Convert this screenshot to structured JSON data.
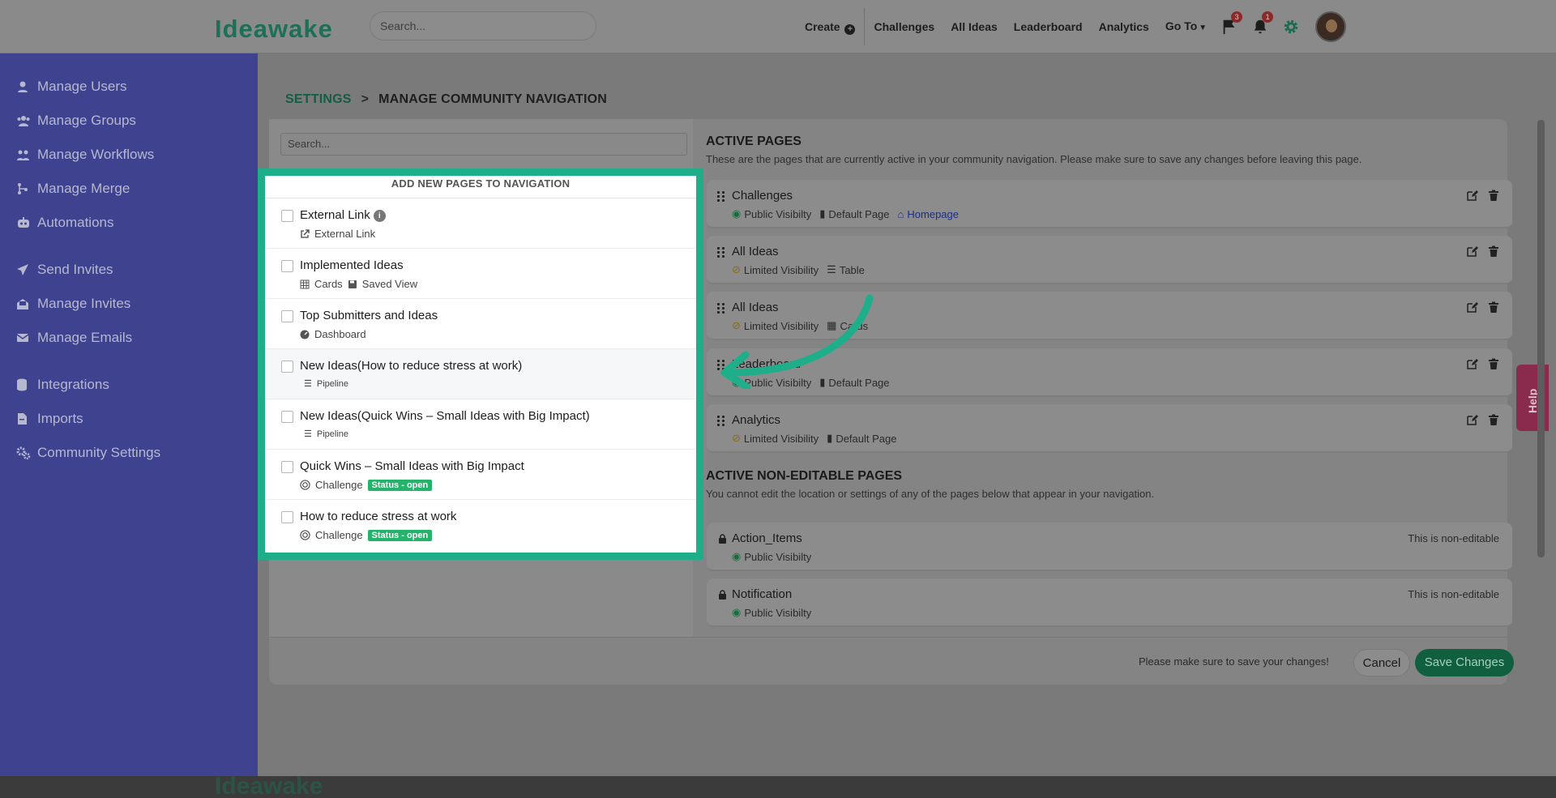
{
  "app": {
    "logo": "Ideawake",
    "search_placeholder": "Search..."
  },
  "topnav": {
    "create": "Create",
    "items": [
      "Challenges",
      "All Ideas",
      "Leaderboard",
      "Analytics"
    ],
    "goto": "Go To",
    "flag_count": "3",
    "bell_count": "1"
  },
  "sidebar": {
    "items": [
      {
        "label": "Manage Users",
        "icon": "user-icon"
      },
      {
        "label": "Manage Groups",
        "icon": "users-icon"
      },
      {
        "label": "Manage Workflows",
        "icon": "workflow-icon"
      },
      {
        "label": "Manage Merge",
        "icon": "merge-icon"
      },
      {
        "label": "Automations",
        "icon": "robot-icon"
      },
      {
        "label": "Send Invites",
        "icon": "paper-plane-icon"
      },
      {
        "label": "Manage Invites",
        "icon": "envelope-open-icon"
      },
      {
        "label": "Manage Emails",
        "icon": "envelope-icon"
      },
      {
        "label": "Integrations",
        "icon": "database-icon"
      },
      {
        "label": "Imports",
        "icon": "file-import-icon"
      },
      {
        "label": "Community Settings",
        "icon": "cogs-icon"
      }
    ]
  },
  "breadcrumb": {
    "parent": "SETTINGS",
    "current": "MANAGE COMMUNITY NAVIGATION"
  },
  "left": {
    "search_placeholder": "Search...",
    "title": "ADD NEW PAGES TO NAVIGATION",
    "rows": [
      {
        "title": "External Link",
        "sub": [
          "External Link"
        ]
      },
      {
        "title": "Implemented Ideas",
        "sub": [
          "Cards",
          "Saved View"
        ]
      },
      {
        "title": "Top Submitters and Ideas",
        "sub": [
          "Dashboard"
        ]
      },
      {
        "title": "New Ideas(How to reduce stress at work)",
        "sub": [
          "Pipeline"
        ]
      },
      {
        "title": "New Ideas(Quick Wins – Small Ideas with Big Impact)",
        "sub": [
          "Pipeline"
        ]
      },
      {
        "title": "Quick Wins – Small Ideas with Big Impact",
        "sub": [
          "Challenge"
        ],
        "status": "Status - open"
      },
      {
        "title": "How to reduce stress at work",
        "sub": [
          "Challenge"
        ],
        "status": "Status - open"
      }
    ]
  },
  "active": {
    "title": "ACTIVE PAGES",
    "desc": "These are the pages that are currently active in your community navigation. Please make sure to save any changes before leaving this page.",
    "pages": [
      {
        "title": "Challenges",
        "meta": [
          "Public Visibilty",
          "Default Page",
          "Homepage"
        ]
      },
      {
        "title": "All Ideas",
        "meta": [
          "Limited Visibility",
          "Table"
        ]
      },
      {
        "title": "All Ideas",
        "meta": [
          "Limited Visibility",
          "Cards"
        ]
      },
      {
        "title": "Leaderboard",
        "meta": [
          "Public Visibilty",
          "Default Page"
        ]
      },
      {
        "title": "Analytics",
        "meta": [
          "Limited Visibility",
          "Default Page"
        ]
      }
    ]
  },
  "nonedit": {
    "title": "ACTIVE NON-EDITABLE PAGES",
    "desc": "You cannot edit the location or settings of any of the pages below that appear in your navigation.",
    "label": "This is non-editable",
    "pages": [
      {
        "title": "Action_Items",
        "meta": "Public Visibilty"
      },
      {
        "title": "Notification",
        "meta": "Public Visibilty"
      }
    ]
  },
  "footer": {
    "note": "Please make sure to save your changes!",
    "cancel": "Cancel",
    "save": "Save Changes"
  },
  "help": "Help",
  "colors": {
    "highlight": "#1fae8a",
    "sidebar": "#3f428e",
    "save": "#10603f"
  }
}
